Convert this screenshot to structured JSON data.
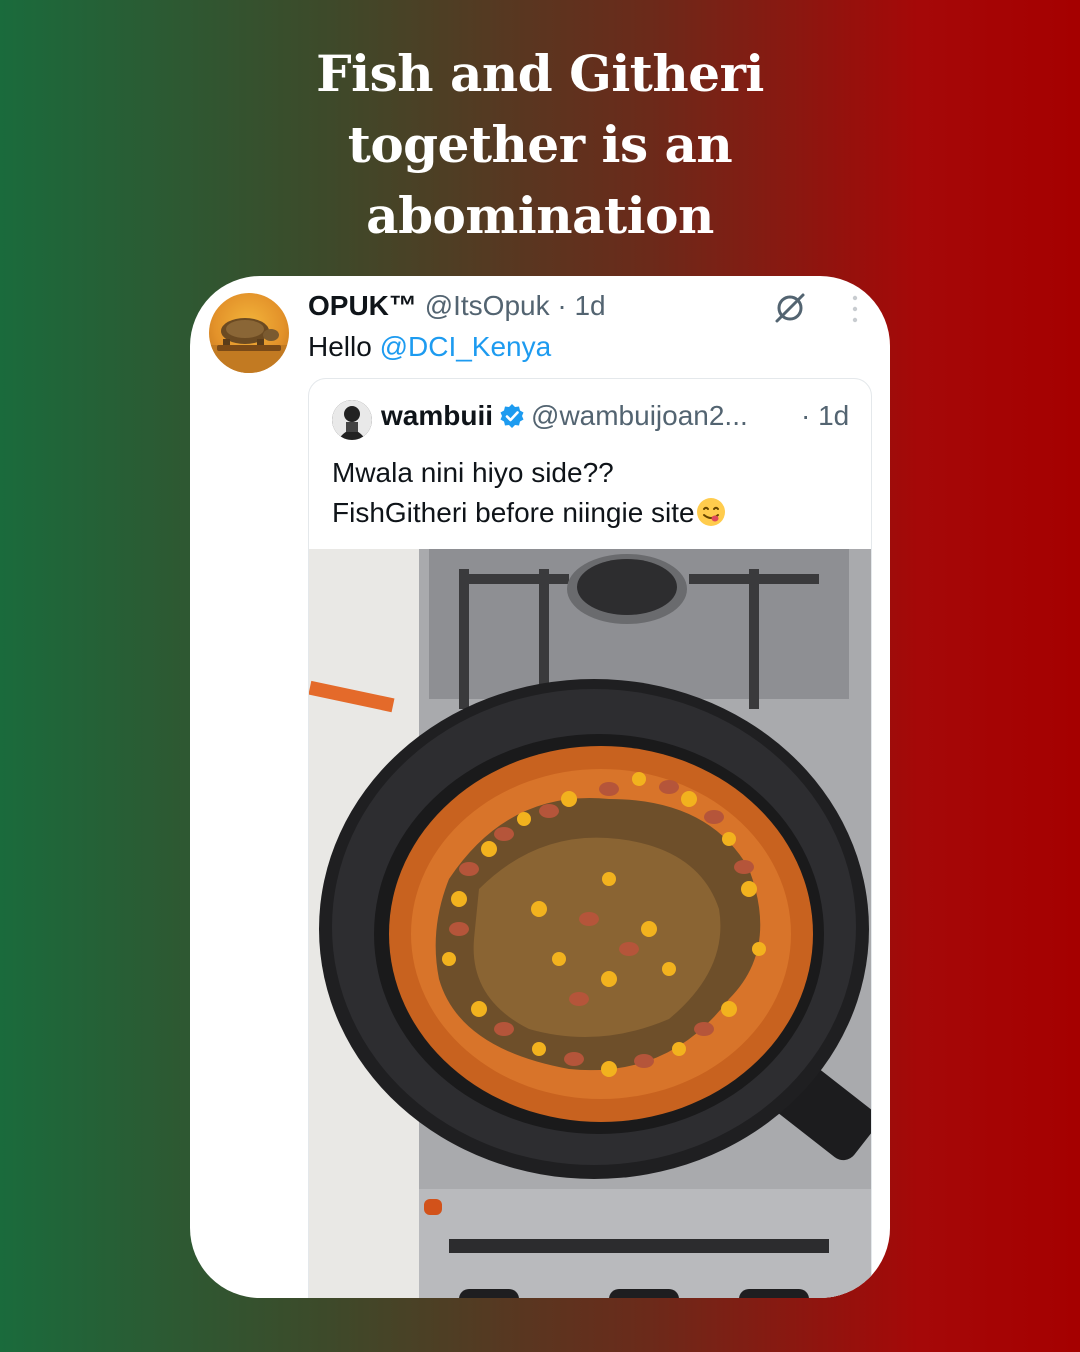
{
  "headline": {
    "line1": "Fish and Githeri",
    "line2": "together is an",
    "line3": "abomination"
  },
  "tweet": {
    "author_name": "OPUK™",
    "author_handle": "@ItsOpuk",
    "time": "· 1d",
    "text_prefix": "Hello ",
    "mention": "@DCI_Kenya",
    "icons": {
      "action": "grok-icon",
      "menu": "more-icon"
    }
  },
  "quoted_tweet": {
    "author_name": "wambuii",
    "author_handle": "@wambuijoan2...",
    "time": "· 1d",
    "line1": "Mwala nini hiyo side??",
    "line2": "FishGitheri before niingie site",
    "emoji": "yum-face-emoji",
    "verified": true,
    "verified_color": "#1d9bf0"
  },
  "colors": {
    "gradient_left": "#1a6b3c",
    "gradient_right": "#a50000",
    "link": "#1d9bf0"
  }
}
